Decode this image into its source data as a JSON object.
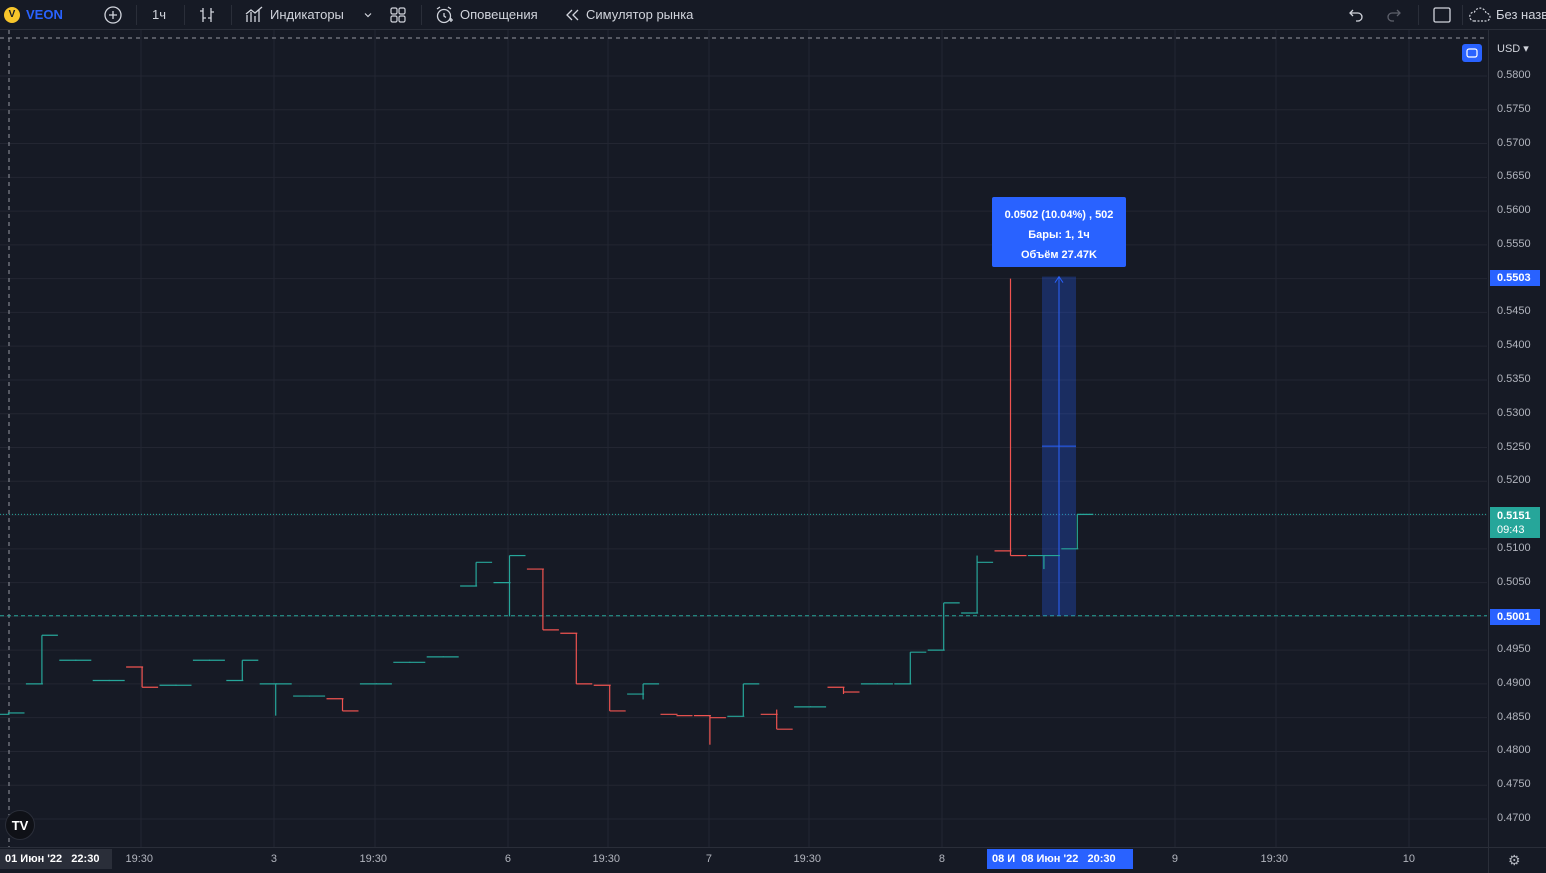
{
  "toolbar": {
    "symbol_logo_letter": "V",
    "symbol": "VEON",
    "interval": "1ч",
    "indicators_label": "Индикаторы",
    "alerts_label": "Оповещения",
    "replay_label": "Симулятор рынка",
    "layout_name": "Без назв"
  },
  "icons": {
    "add_symbol": "plus-circle-icon",
    "bar_style": "bars-icon",
    "indicators": "indicators-icon",
    "templates": "grid-icon",
    "alerts": "alarm-clock-icon",
    "replay": "rewind-icon",
    "undo": "undo-icon",
    "redo": "redo-icon",
    "fullscreen": "square-icon",
    "cloud": "cloud-icon",
    "settings": "gear-icon"
  },
  "price_axis": {
    "currency": "USD",
    "ticks": [
      "0.5800",
      "0.5750",
      "0.5700",
      "0.5650",
      "0.5600",
      "0.5550",
      "0.5450",
      "0.5400",
      "0.5350",
      "0.5300",
      "0.5250",
      "0.5200",
      "0.5100",
      "0.5050",
      "0.4950",
      "0.4900",
      "0.4850",
      "0.4800",
      "0.4750",
      "0.4700"
    ],
    "badge_measure_top": "0.5503",
    "badge_last_price": "0.5151",
    "badge_countdown": "09:43",
    "badge_measure_bottom": "0.5001"
  },
  "time_axis": {
    "ticks": [
      "19:30",
      "3",
      "19:30",
      "6",
      "19:30",
      "7",
      "19:30",
      "8",
      "9",
      "19:30",
      "10"
    ],
    "badge_left": "01 Июн '22   22:30",
    "badge_measure_start": "08 И",
    "badge_measure_end": "08 Июн '22   20:30"
  },
  "measure_tooltip": {
    "line1": "0.0502 (10.04%) , 502",
    "line2": "Бары: 1, 1ч",
    "line3": "Объём 27.47K"
  },
  "logo_text": "TV",
  "colors": {
    "background": "#161a25",
    "up": "#26a69a",
    "down": "#ef5350",
    "accent": "#2962ff",
    "last_price": "#26a69a"
  },
  "chart_data": {
    "type": "ohlc-step",
    "symbol": "VEON",
    "interval": "1h",
    "ylim": [
      0.466,
      0.584
    ],
    "bars": [
      {
        "o": 0.4855,
        "h": 0.4858,
        "l": 0.4855,
        "c": 0.4857
      },
      {
        "o": 0.49,
        "h": 0.4972,
        "l": 0.49,
        "c": 0.4972
      },
      {
        "o": 0.4935,
        "h": 0.4935,
        "l": 0.4935,
        "c": 0.4935
      },
      {
        "o": 0.4905,
        "h": 0.4905,
        "l": 0.4905,
        "c": 0.4905
      },
      {
        "o": 0.4925,
        "h": 0.4925,
        "l": 0.4895,
        "c": 0.4895
      },
      {
        "o": 0.4898,
        "h": 0.4898,
        "l": 0.4898,
        "c": 0.4898
      },
      {
        "o": 0.4935,
        "h": 0.4935,
        "l": 0.4935,
        "c": 0.4935
      },
      {
        "o": 0.4905,
        "h": 0.4935,
        "l": 0.4905,
        "c": 0.4935
      },
      {
        "o": 0.49,
        "h": 0.49,
        "l": 0.4853,
        "c": 0.49
      },
      {
        "o": 0.4882,
        "h": 0.4882,
        "l": 0.4882,
        "c": 0.4882
      },
      {
        "o": 0.4878,
        "h": 0.4878,
        "l": 0.486,
        "c": 0.486
      },
      {
        "o": 0.49,
        "h": 0.49,
        "l": 0.49,
        "c": 0.49
      },
      {
        "o": 0.4932,
        "h": 0.4932,
        "l": 0.4932,
        "c": 0.4932
      },
      {
        "o": 0.494,
        "h": 0.494,
        "l": 0.494,
        "c": 0.494
      },
      {
        "o": 0.5045,
        "h": 0.508,
        "l": 0.5045,
        "c": 0.508
      },
      {
        "o": 0.505,
        "h": 0.509,
        "l": 0.5,
        "c": 0.509
      },
      {
        "o": 0.507,
        "h": 0.507,
        "l": 0.498,
        "c": 0.498
      },
      {
        "o": 0.4975,
        "h": 0.4975,
        "l": 0.49,
        "c": 0.49
      },
      {
        "o": 0.4898,
        "h": 0.4898,
        "l": 0.486,
        "c": 0.486
      },
      {
        "o": 0.4885,
        "h": 0.49,
        "l": 0.4877,
        "c": 0.49
      },
      {
        "o": 0.4855,
        "h": 0.4855,
        "l": 0.4855,
        "c": 0.4853
      },
      {
        "o": 0.4853,
        "h": 0.4853,
        "l": 0.481,
        "c": 0.485
      },
      {
        "o": 0.4852,
        "h": 0.49,
        "l": 0.4852,
        "c": 0.49
      },
      {
        "o": 0.4855,
        "h": 0.4862,
        "l": 0.4833,
        "c": 0.4833
      },
      {
        "o": 0.4866,
        "h": 0.4866,
        "l": 0.4866,
        "c": 0.4866
      },
      {
        "o": 0.4895,
        "h": 0.4895,
        "l": 0.4885,
        "c": 0.4888
      },
      {
        "o": 0.49,
        "h": 0.49,
        "l": 0.49,
        "c": 0.49
      },
      {
        "o": 0.49,
        "h": 0.4947,
        "l": 0.49,
        "c": 0.4947
      },
      {
        "o": 0.495,
        "h": 0.502,
        "l": 0.495,
        "c": 0.502
      },
      {
        "o": 0.5005,
        "h": 0.509,
        "l": 0.5005,
        "c": 0.508
      },
      {
        "o": 0.5097,
        "h": 0.55,
        "l": 0.509,
        "c": 0.509
      },
      {
        "o": 0.509,
        "h": 0.509,
        "l": 0.507,
        "c": 0.509
      },
      {
        "o": 0.51,
        "h": 0.5151,
        "l": 0.51,
        "c": 0.5151
      }
    ],
    "price_levels": {
      "last_price": 0.5151,
      "measure_high": 0.5503,
      "measure_low": 0.5001
    },
    "measure": {
      "change": 0.0502,
      "change_percent": 10.04,
      "ticks": 502,
      "bars": 1,
      "volume": "27.47K"
    }
  }
}
